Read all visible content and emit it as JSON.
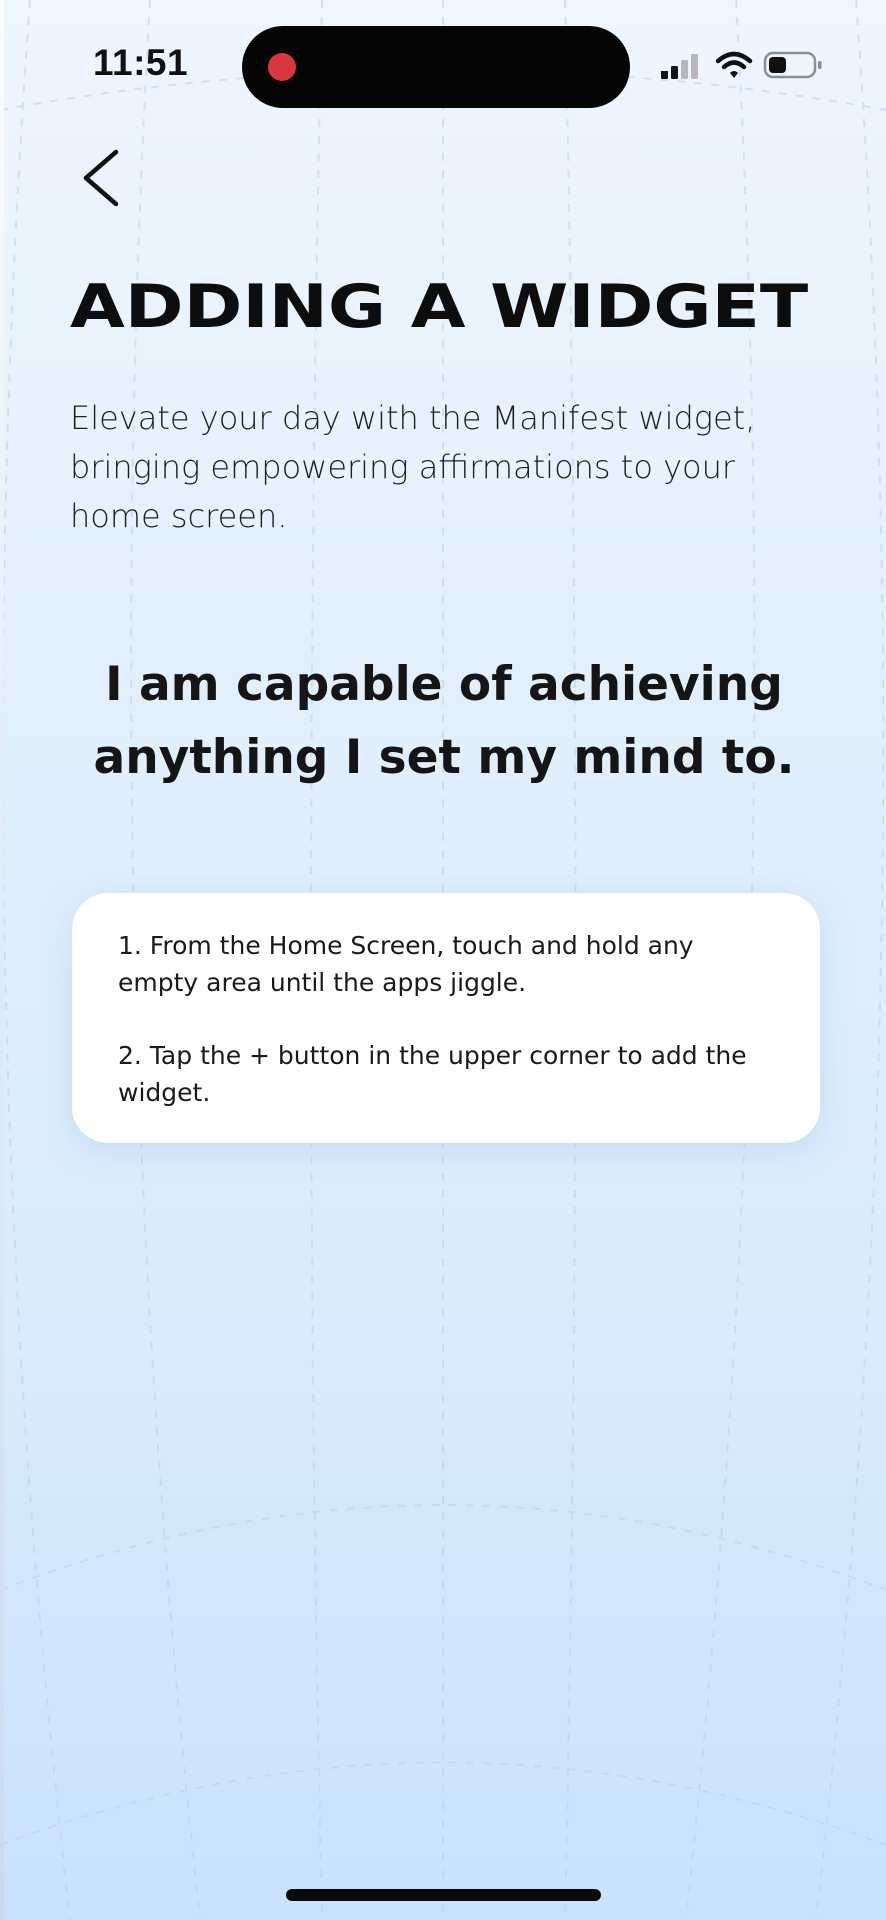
{
  "status_bar": {
    "time": "11:51",
    "icons": [
      "record-indicator",
      "cellular-signal-icon",
      "wifi-icon",
      "battery-icon"
    ]
  },
  "navigation": {
    "back_icon": "chevron-left-icon"
  },
  "page": {
    "title": "ADDING A WIDGET",
    "intro": "Elevate your day with the Manifest widget, bringing empowering affirmations to your home screen.",
    "affirmation": "I am capable of achieving anything I set my mind to."
  },
  "instructions": {
    "steps": [
      "1. From the Home Screen, touch and hold any empty area until the apps jiggle.",
      "2. Tap the + button in the upper corner to add the widget."
    ]
  },
  "colors": {
    "background_top": "#eef6ff",
    "background_bottom": "#c9e2fb",
    "card": "#ffffff",
    "record_dot": "#d9363e",
    "text": "#111111"
  }
}
